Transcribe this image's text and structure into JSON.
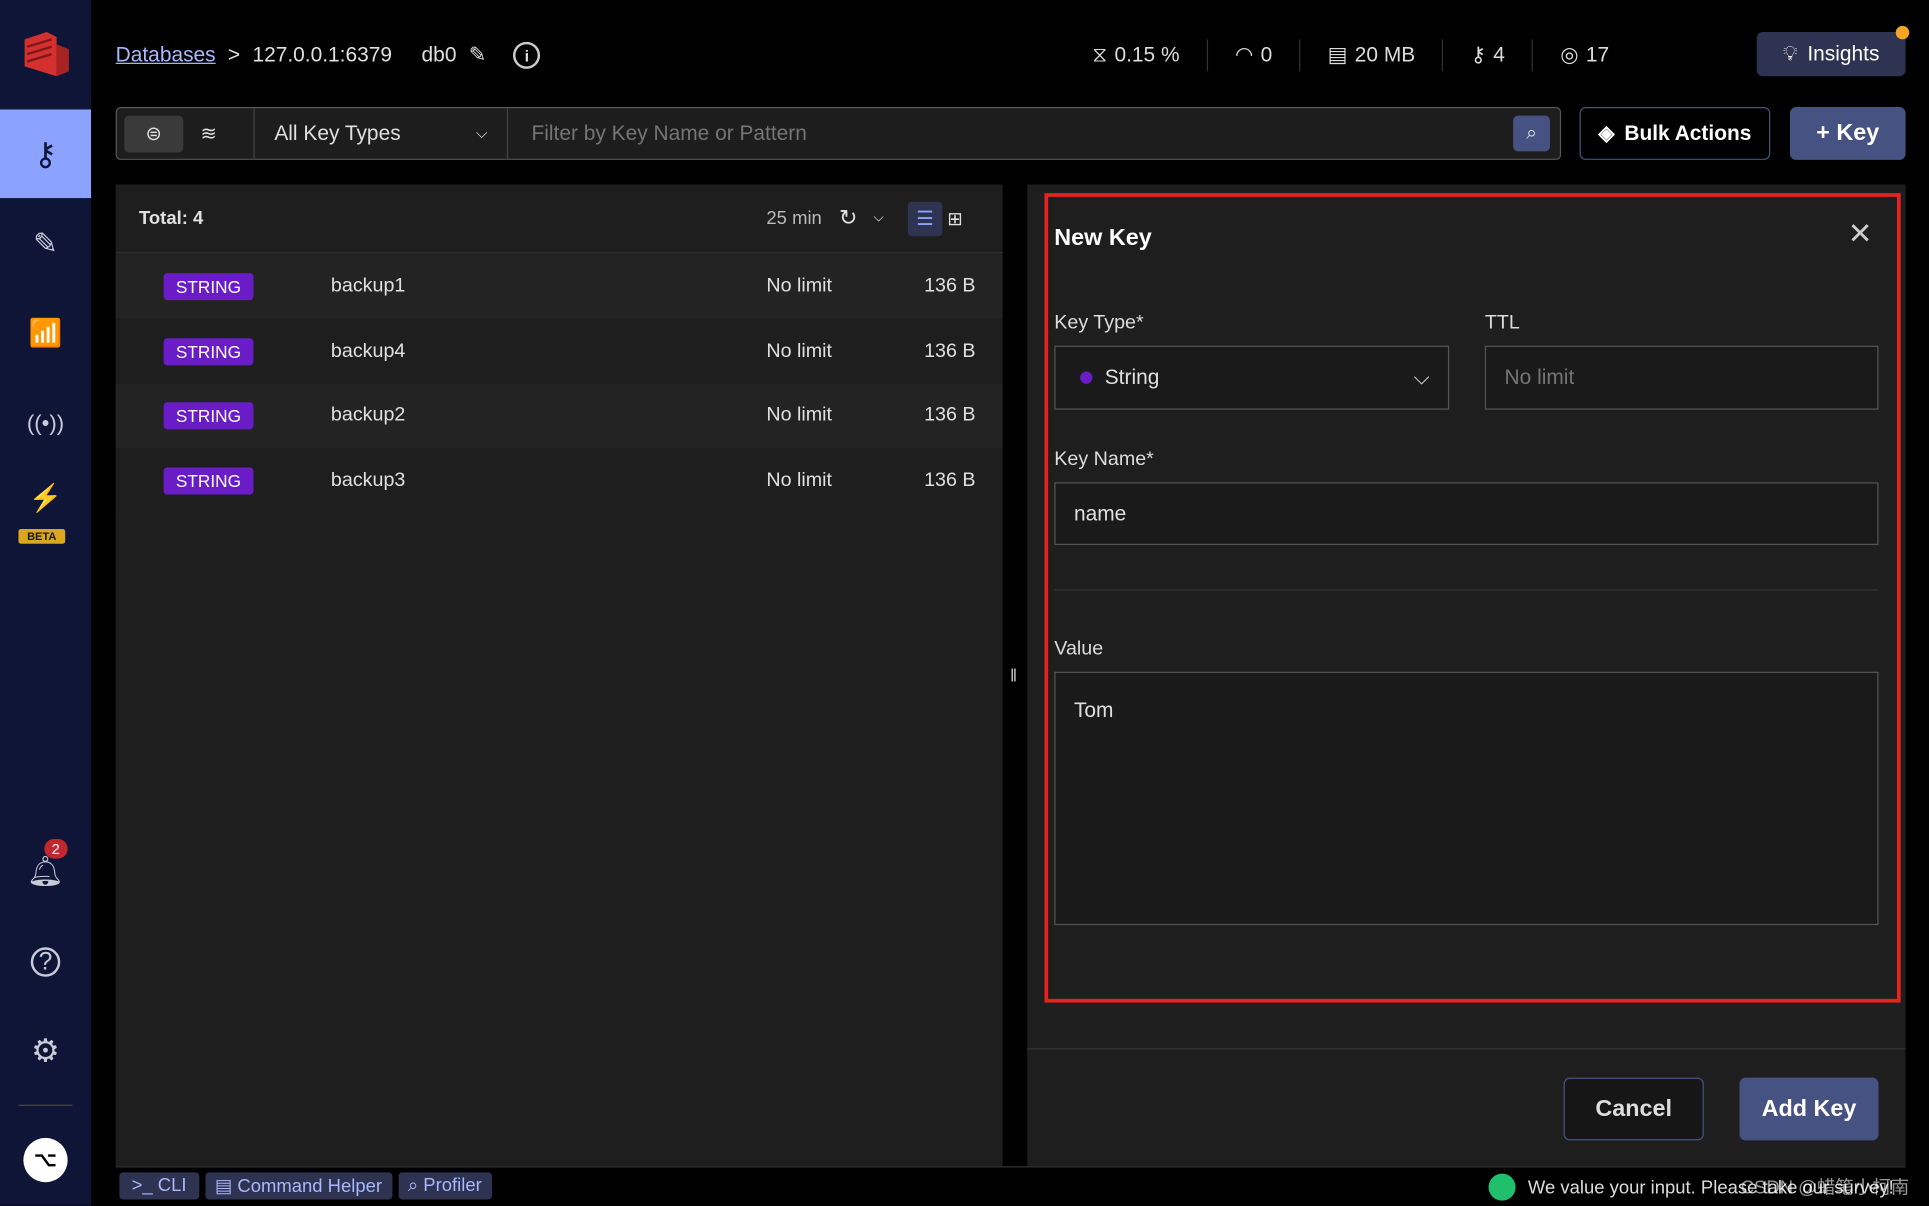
{
  "sidebar": {
    "items": [
      {
        "icon": "key-icon",
        "label": "Browser"
      },
      {
        "icon": "edit-icon",
        "label": "Workbench"
      },
      {
        "icon": "analytics-icon",
        "label": "Analysis"
      },
      {
        "icon": "pubsub-icon",
        "label": "Pub/Sub"
      },
      {
        "icon": "triggers-icon",
        "label": "Triggers"
      }
    ],
    "beta": "BETA",
    "notifications": "2"
  },
  "header": {
    "databases": "Databases",
    "sep": ">",
    "host": "127.0.0.1:6379",
    "db": "db0",
    "stats": {
      "cpu": "0.15 %",
      "ops": "0",
      "memory": "20 MB",
      "keys": "4",
      "clients": "17"
    },
    "insights": "Insights"
  },
  "filter": {
    "key_type": "All Key Types",
    "placeholder": "Filter by Key Name or Pattern",
    "bulk": "Bulk Actions",
    "add_key": "+ Key"
  },
  "list": {
    "total": "Total: 4",
    "refresh": "25 min",
    "rows": [
      {
        "type": "STRING",
        "name": "backup1",
        "ttl": "No limit",
        "size": "136 B"
      },
      {
        "type": "STRING",
        "name": "backup4",
        "ttl": "No limit",
        "size": "136 B"
      },
      {
        "type": "STRING",
        "name": "backup2",
        "ttl": "No limit",
        "size": "136 B"
      },
      {
        "type": "STRING",
        "name": "backup3",
        "ttl": "No limit",
        "size": "136 B"
      }
    ]
  },
  "form": {
    "title": "New Key",
    "key_type_label": "Key Type*",
    "key_type": "String",
    "ttl_label": "TTL",
    "ttl_placeholder": "No limit",
    "key_name_label": "Key Name*",
    "key_name": "name",
    "value_label": "Value",
    "value": "Tom",
    "cancel": "Cancel",
    "submit": "Add Key"
  },
  "footer": {
    "cli": ">_ CLI",
    "helper": "Command Helper",
    "profiler": "Profiler",
    "survey": "We value your input. Please take our survey!",
    "watermark": "CSDN @蜡笔小柯南"
  },
  "colors": {
    "accent": "#465282",
    "string_tag": "#6a1dc7",
    "highlight": "#e8231f"
  }
}
